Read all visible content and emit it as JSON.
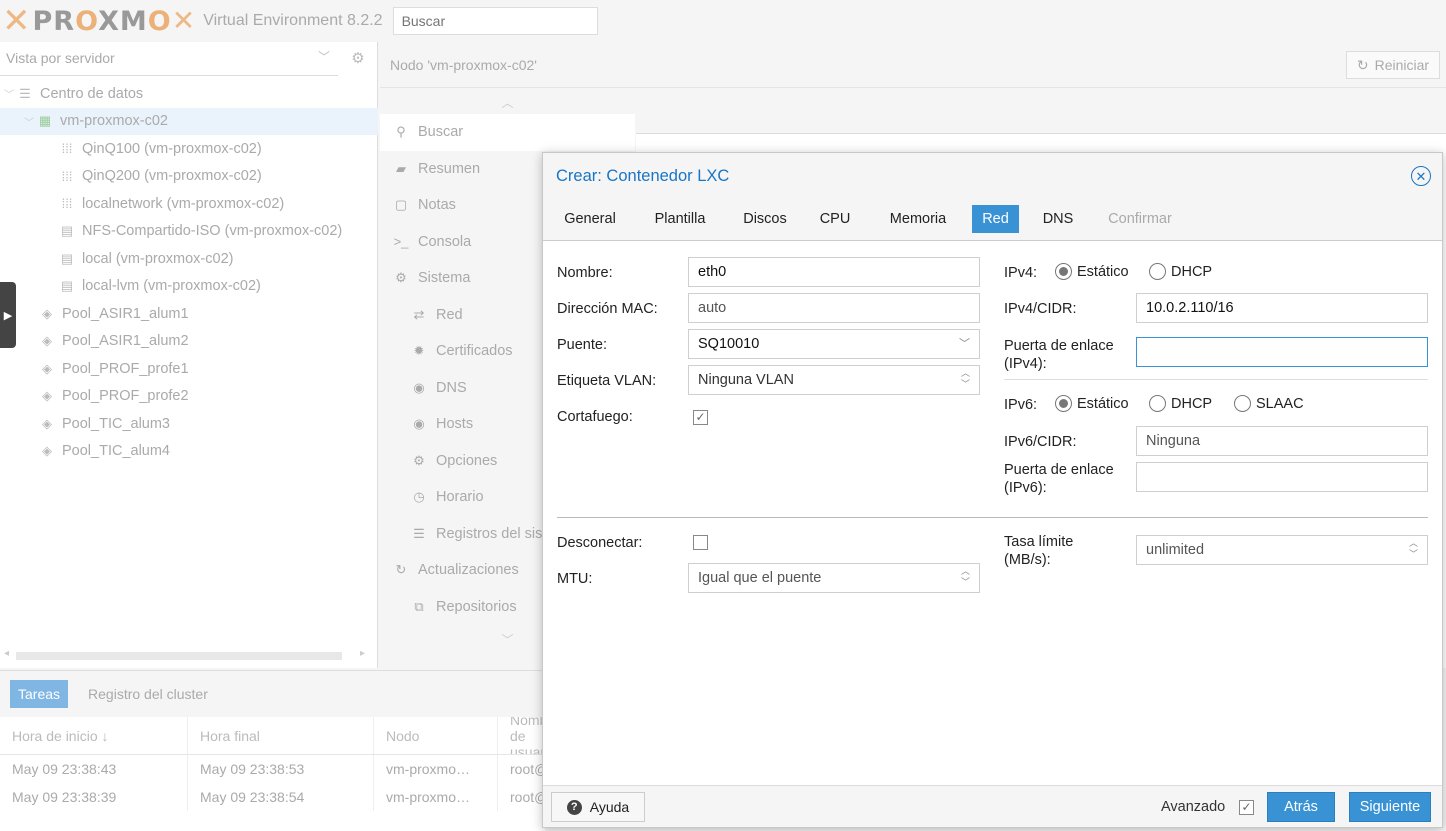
{
  "header": {
    "logo_text": "PROXMOX",
    "version": "Virtual Environment 8.2.2",
    "search_placeholder": "Buscar"
  },
  "left": {
    "view_select": "Vista por servidor",
    "tree": [
      {
        "label": "Centro de datos",
        "icon": "datacenter-icon"
      },
      {
        "label": "vm-proxmox-c02",
        "icon": "server-icon"
      },
      {
        "label": "QinQ100 (vm-proxmox-c02)",
        "icon": "network-grid-icon"
      },
      {
        "label": "QinQ200 (vm-proxmox-c02)",
        "icon": "network-grid-icon"
      },
      {
        "label": "localnetwork (vm-proxmox-c02)",
        "icon": "network-grid-icon"
      },
      {
        "label": "NFS-Compartido-ISO (vm-proxmox-c02)",
        "icon": "storage-icon"
      },
      {
        "label": "local (vm-proxmox-c02)",
        "icon": "storage-icon"
      },
      {
        "label": "local-lvm (vm-proxmox-c02)",
        "icon": "storage-icon"
      },
      {
        "label": "Pool_ASIR1_alum1",
        "icon": "tags-icon"
      },
      {
        "label": "Pool_ASIR1_alum2",
        "icon": "tags-icon"
      },
      {
        "label": "Pool_PROF_profe1",
        "icon": "tags-icon"
      },
      {
        "label": "Pool_PROF_profe2",
        "icon": "tags-icon"
      },
      {
        "label": "Pool_TIC_alum3",
        "icon": "tags-icon"
      },
      {
        "label": "Pool_TIC_alum4",
        "icon": "tags-icon"
      }
    ]
  },
  "node": {
    "title": "Nodo 'vm-proxmox-c02'",
    "restart": "Reiniciar",
    "menu": [
      {
        "label": "Buscar",
        "icon": "search-icon"
      },
      {
        "label": "Resumen",
        "icon": "book-icon"
      },
      {
        "label": "Notas",
        "icon": "note-icon"
      },
      {
        "label": "Consola",
        "icon": "terminal-icon"
      },
      {
        "label": "Sistema",
        "icon": "cogs-icon"
      },
      {
        "label": "Red",
        "icon": "exchange-icon"
      },
      {
        "label": "Certificados",
        "icon": "certificate-icon"
      },
      {
        "label": "DNS",
        "icon": "globe-icon"
      },
      {
        "label": "Hosts",
        "icon": "globe-icon"
      },
      {
        "label": "Opciones",
        "icon": "gear-icon"
      },
      {
        "label": "Horario",
        "icon": "clock-icon"
      },
      {
        "label": "Registros del sistema",
        "icon": "list-icon"
      },
      {
        "label": "Actualizaciones",
        "icon": "refresh-icon"
      },
      {
        "label": "Repositorios",
        "icon": "files-icon"
      }
    ]
  },
  "bottom": {
    "tabs": [
      "Tareas",
      "Registro del cluster"
    ],
    "columns": [
      "Hora de inicio ↓",
      "Hora final",
      "Nodo",
      "Nombre de usuario"
    ],
    "rows": [
      [
        "May 09 23:38:43",
        "May 09 23:38:53",
        "vm-proxmo…",
        "root@pam"
      ],
      [
        "May 09 23:38:39",
        "May 09 23:38:54",
        "vm-proxmo…",
        "root@pam"
      ]
    ]
  },
  "dialog": {
    "title": "Crear: Contenedor LXC",
    "tabs": [
      "General",
      "Plantilla",
      "Discos",
      "CPU",
      "Memoria",
      "Red",
      "DNS",
      "Confirmar"
    ],
    "form": {
      "name_label": "Nombre:",
      "name_value": "eth0",
      "mac_label": "Dirección MAC:",
      "mac_value": "auto",
      "bridge_label": "Puente:",
      "bridge_value": "SQ10010",
      "vlan_label": "Etiqueta VLAN:",
      "vlan_value": "Ninguna VLAN",
      "firewall_label": "Cortafuego:",
      "firewall_checked": true,
      "ipv4_label": "IPv4:",
      "ipv4_static": "Estático",
      "ipv4_dhcp": "DHCP",
      "ipv4_mode": "static",
      "ipv4_cidr_label": "IPv4/CIDR:",
      "ipv4_cidr_value": "10.0.2.110/16",
      "gw4_label": "Puerta de enlace (IPv4):",
      "gw4_value": "",
      "ipv6_label": "IPv6:",
      "ipv6_static": "Estático",
      "ipv6_dhcp": "DHCP",
      "ipv6_slaac": "SLAAC",
      "ipv6_mode": "static",
      "ipv6_cidr_label": "IPv6/CIDR:",
      "ipv6_cidr_value": "Ninguna",
      "gw6_label": "Puerta de enlace (IPv6):",
      "gw6_value": "",
      "disconnect_label": "Desconectar:",
      "disconnect_checked": false,
      "mtu_label": "MTU:",
      "mtu_value": "Igual que el puente",
      "rate_label": "Tasa límite (MB/s):",
      "rate_value": "unlimited"
    },
    "footer": {
      "help": "Ayuda",
      "advanced": "Avanzado",
      "advanced_checked": true,
      "back": "Atrás",
      "next": "Siguiente"
    }
  },
  "colors": {
    "accent": "#3892d4",
    "title_blue": "#1a75c5",
    "brand_orange": "#e57000"
  }
}
